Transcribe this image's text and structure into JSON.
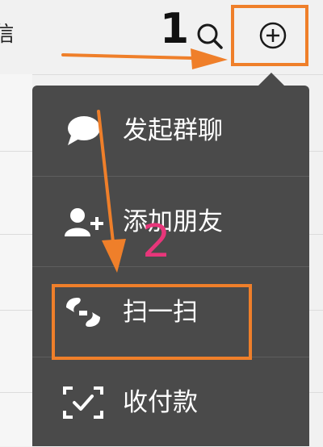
{
  "header": {
    "title_cut": "信",
    "search_icon": "search-icon",
    "plus_icon": "plus-circle-icon"
  },
  "annotations": {
    "step1": "1",
    "step2": "2",
    "step1_color": "#111111",
    "step2_color": "#e8367a",
    "highlight_color": "#ef7f2a"
  },
  "menu": {
    "background": "#4a4a4a",
    "items": [
      {
        "label": "发起群聊",
        "icon": "chat-bubble-icon"
      },
      {
        "label": "添加朋友",
        "icon": "add-friend-icon"
      },
      {
        "label": "扫一扫",
        "icon": "scan-icon"
      },
      {
        "label": "收付款",
        "icon": "payment-scan-icon"
      }
    ]
  }
}
